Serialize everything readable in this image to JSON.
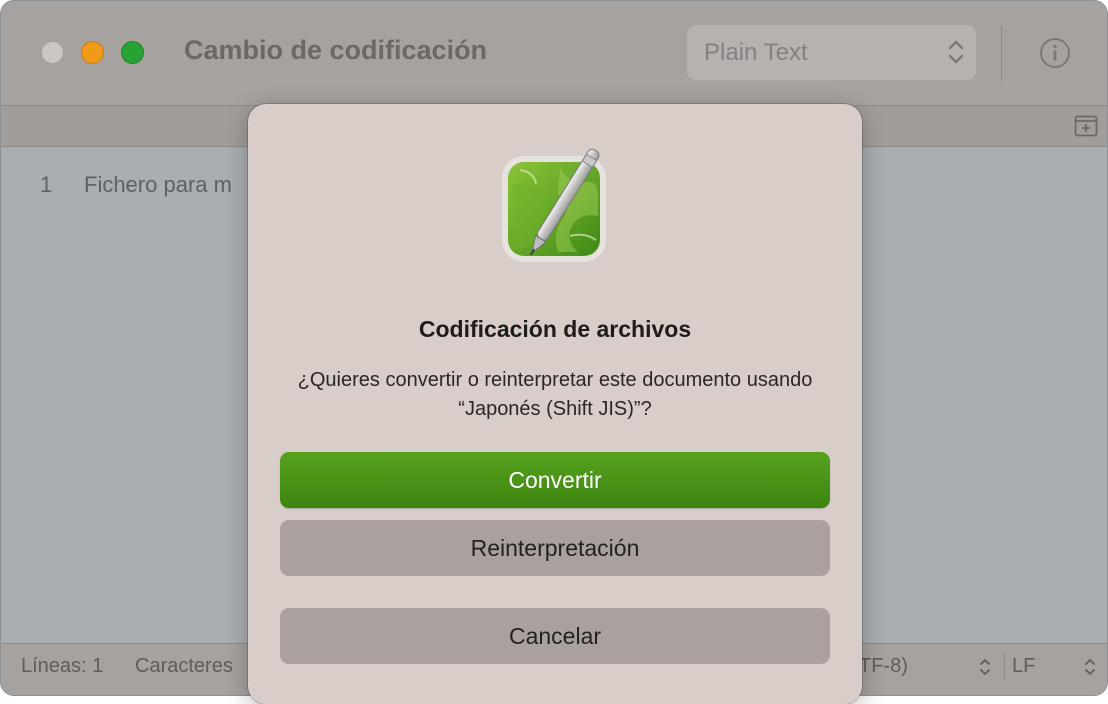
{
  "window": {
    "title": "Cambio de codificación",
    "syntax": "Plain Text"
  },
  "editor": {
    "lines": [
      {
        "number": "1",
        "text": "Fichero para m"
      }
    ]
  },
  "statusbar": {
    "lines": "Líneas: 1",
    "chars": "Caracteres",
    "encoding": "TF-8)",
    "line_ending": "LF"
  },
  "dialog": {
    "title": "Codificación de archivos",
    "message": "¿Quieres convertir o reinterpretar este documento usando “Japonés (Shift JIS)”?",
    "buttons": {
      "convert": "Convertir",
      "reinterpret": "Reinterpretación",
      "cancel": "Cancelar"
    }
  },
  "icons": {
    "close": "close-icon",
    "minimize": "minimize-icon",
    "maximize": "maximize-icon",
    "chevron": "chevron-updown-icon",
    "info": "info-icon",
    "split": "split-editor-icon",
    "app": "coteditor-app-icon"
  },
  "colors": {
    "accent": "#4b9a18",
    "close": "#cdc6c1",
    "minimize": "#f09a1a",
    "maximize": "#27a234"
  }
}
